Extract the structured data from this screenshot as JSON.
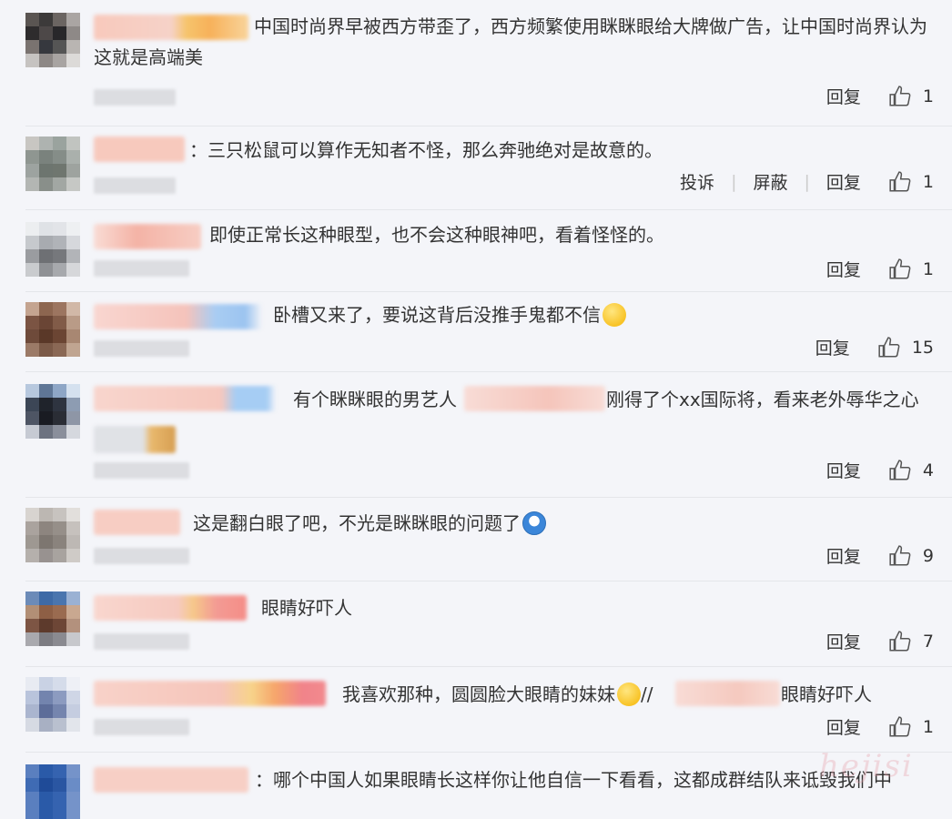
{
  "comments": [
    {
      "text": "中国时尚界早被西方带歪了，西方频繁使用眯眯眼给大牌做广告，让中国时尚界认为这就是高端美",
      "actions": [
        "回复"
      ],
      "likes": "1"
    },
    {
      "text": "：三只松鼠可以算作无知者不怪，那么奔驰绝对是故意的。",
      "actions": [
        "投诉",
        "屏蔽",
        "回复"
      ],
      "likes": "1"
    },
    {
      "text": "即使正常长这种眼型，也不会这种眼神吧，看着怪怪的。",
      "actions": [
        "回复"
      ],
      "likes": "1"
    },
    {
      "text": "卧槽又来了，要说这背后没推手鬼都不信",
      "actions": [
        "回复"
      ],
      "likes": "15",
      "emoji": "sweat-face-emoji"
    },
    {
      "text_a": "有个眯眯眼的男艺人",
      "text_b": "刚得了个xx国际将，看来老外辱华之心",
      "actions": [
        "回复"
      ],
      "likes": "4"
    },
    {
      "text": "这是翻白眼了吧，不光是眯眯眼的问题了",
      "actions": [
        "回复"
      ],
      "likes": "9",
      "emoji": "doraemon-emoji"
    },
    {
      "text": "眼睛好吓人",
      "actions": [
        "回复"
      ],
      "likes": "7"
    },
    {
      "text_a": "我喜欢那种，圆圆脸大眼睛的妹妹",
      "text_b": "//",
      "text_c": "眼睛好吓人",
      "actions": [
        "回复"
      ],
      "likes": "1",
      "emoji": "yum-face-emoji"
    },
    {
      "text": "：哪个中国人如果眼睛长这样你让他自信一下看看，这都成群结队来诋毁我们中"
    }
  ],
  "watermark": "hejisi",
  "colors": {
    "background": "#f4f5f9",
    "text": "#333333",
    "divider": "#e4e6ea"
  }
}
